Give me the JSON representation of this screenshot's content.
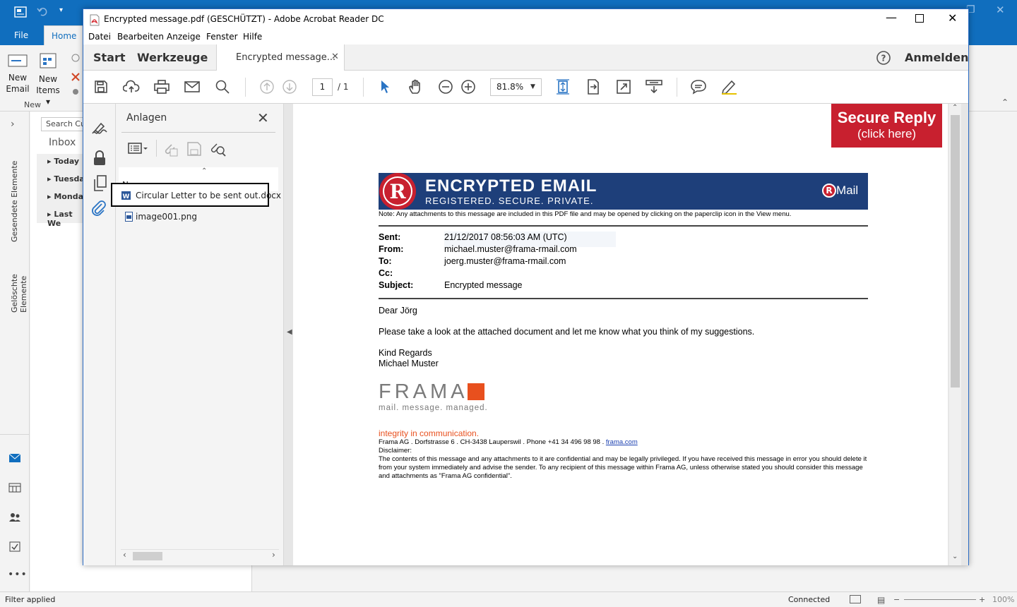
{
  "outlook": {
    "tabs": {
      "file": "File",
      "home": "Home"
    },
    "ribbon": {
      "new_email": "New\nEmail",
      "new_email_l1": "New",
      "new_email_l2": "Email",
      "new_items_l1": "New",
      "new_items_l2": "Items",
      "group_new": "New"
    },
    "search_placeholder": "Search Cu",
    "inbox": "Inbox",
    "groups": [
      "Today",
      "Tuesda",
      "Monda",
      "Last We"
    ],
    "vertical": {
      "sent": "Gesendete Elemente",
      "deleted": "Gelöschte Elemente"
    },
    "status": {
      "filter": "Filter applied",
      "connected": "Connected",
      "zoom": "100%"
    }
  },
  "acrobat": {
    "title": "Encrypted message.pdf (GESCHÜTZT) - Adobe Acrobat Reader DC",
    "menu": [
      "Datei",
      "Bearbeiten",
      "Anzeige",
      "Fenster",
      "Hilfe"
    ],
    "tabs": {
      "start": "Start",
      "tools": "Werkzeuge",
      "doc": "Encrypted message..."
    },
    "signin": "Anmelden",
    "page_current": "1",
    "page_total": "/ 1",
    "zoom": "81.8%",
    "attachments": {
      "title": "Anlagen",
      "column": "Name",
      "items": [
        "Circular Letter to be sent out.docx",
        "image001.png"
      ]
    }
  },
  "pdf": {
    "secure_reply": {
      "line1": "Secure Reply",
      "line2": "(click here)"
    },
    "banner": {
      "title": "ENCRYPTED EMAIL",
      "subtitle": "REGISTERED. SECURE. PRIVATE.",
      "brand": "Mail",
      "logo_letter": "R"
    },
    "note": "Note: Any attachments to this message are included in this PDF file and may be opened by clicking on the paperclip icon in the View menu.",
    "headers": [
      {
        "label": "Sent:",
        "value": "21/12/2017 08:56:03 AM (UTC)"
      },
      {
        "label": "From:",
        "value": "michael.muster@frama-rmail.com"
      },
      {
        "label": "To:",
        "value": "joerg.muster@frama-rmail.com"
      },
      {
        "label": "Cc:",
        "value": ""
      },
      {
        "label": "Subject:",
        "value": "Encrypted message"
      }
    ],
    "greeting": "Dear Jörg",
    "body": "Please take a look at the attached document and let me know what you think of my suggestions.",
    "closing1": "Kind Regards",
    "closing2": "Michael Muster",
    "frama_logo": "FRAMA",
    "frama_tagline": "mail. message. managed.",
    "integrity": "integrity in communication.",
    "address": "Frama AG . Dorfstrasse 6 . CH-3438 Lauperswil . Phone +41 34 496 98 98 .",
    "link": "frama.com",
    "disclaimer_title": "Disclaimer:",
    "disclaimer": "The contents of this message and any attachments to it are confidential and may be legally privileged. If you have received this message in error you should delete it from your system immediately and advise the sender. To any recipient of this message within Frama AG, unless otherwise stated you should consider this message and attachments as \"Frama AG confidential\"."
  },
  "colors": {
    "outlook_blue": "#106ebe",
    "banner_navy": "#1e3f7a",
    "rmail_red": "#c8202f",
    "frama_orange": "#e8501e"
  }
}
